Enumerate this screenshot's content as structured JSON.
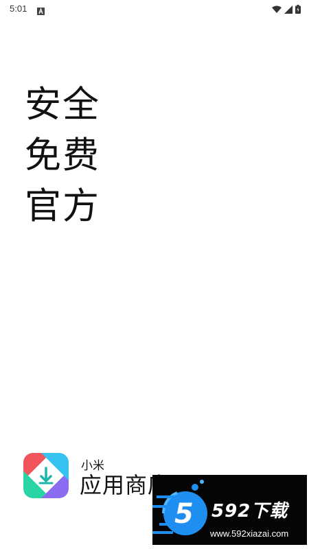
{
  "status_bar": {
    "time": "5:01",
    "icons": [
      "notification-a-icon",
      "wifi-icon",
      "signal-icon",
      "battery-icon"
    ]
  },
  "slogan": [
    "安全",
    "免费",
    "官方"
  ],
  "brand": {
    "subtitle": "小米",
    "title": "应用商店",
    "logo_colors": [
      "#f2545b",
      "#2bd4a4",
      "#8b6cf0",
      "#36c2f0"
    ]
  },
  "watermark": {
    "logo_char": "5",
    "title": "592下载",
    "url": "www.592xiazai.com",
    "accent": "#1e8ff0"
  }
}
